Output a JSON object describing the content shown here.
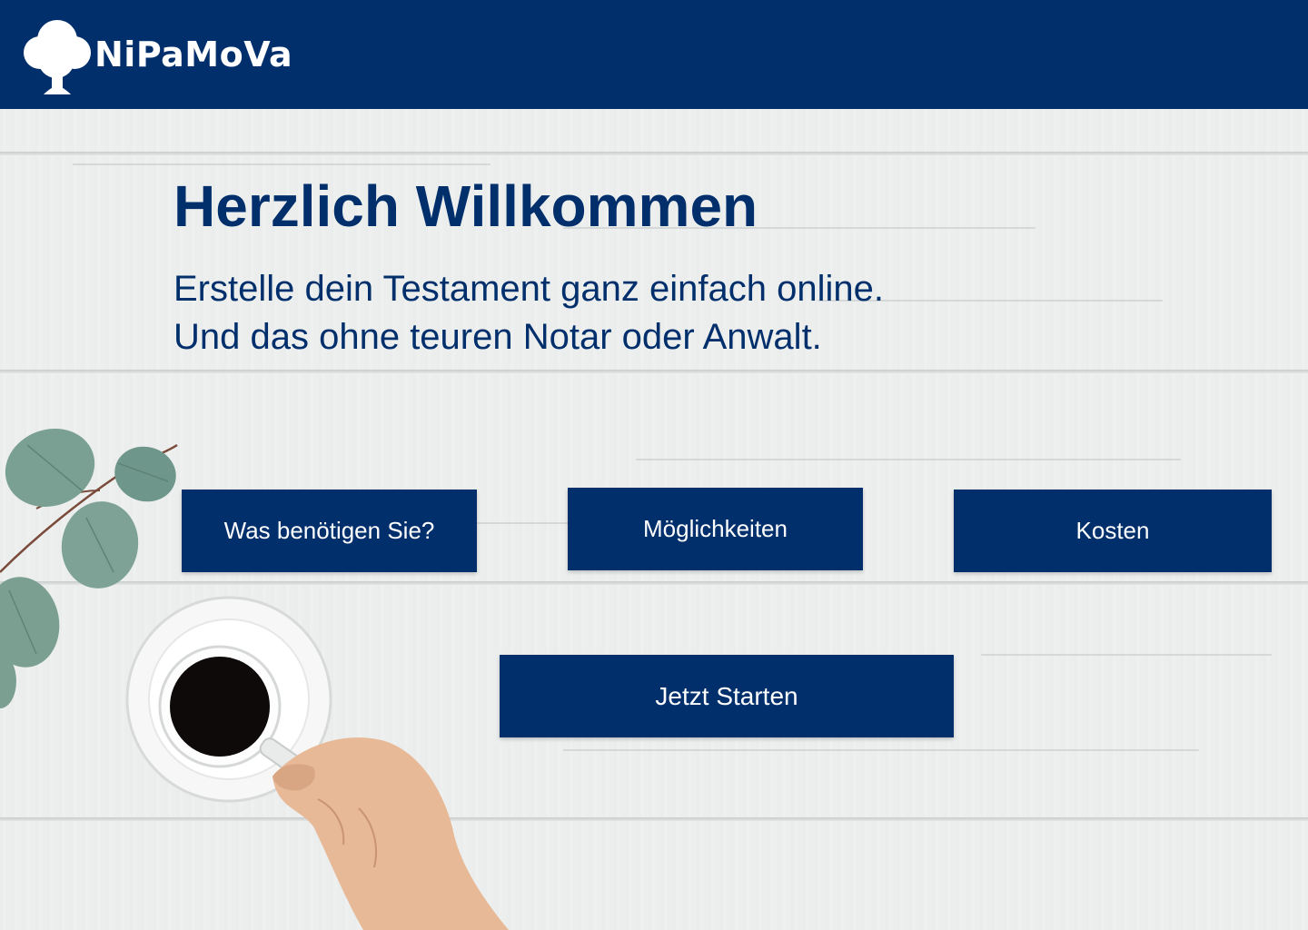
{
  "header": {
    "brand": "NiPaMoVa",
    "logo_icon": "tree-icon",
    "background_color": "#002f6c"
  },
  "hero": {
    "title": "Herzlich Willkommen",
    "subtitle_line1": "Erstelle dein Testament ganz einfach online.",
    "subtitle_line2": "Und das ohne teuren Notar oder Anwalt."
  },
  "buttons": {
    "needs": "Was benötigen Sie?",
    "options": "Möglichkeiten",
    "costs": "Kosten",
    "start": "Jetzt Starten"
  },
  "colors": {
    "primary": "#002f6c",
    "button_text": "#ffffff",
    "background": "#eef0f0"
  },
  "decor": {
    "image_subject": "coffee-cup-with-hand-and-eucalyptus"
  }
}
